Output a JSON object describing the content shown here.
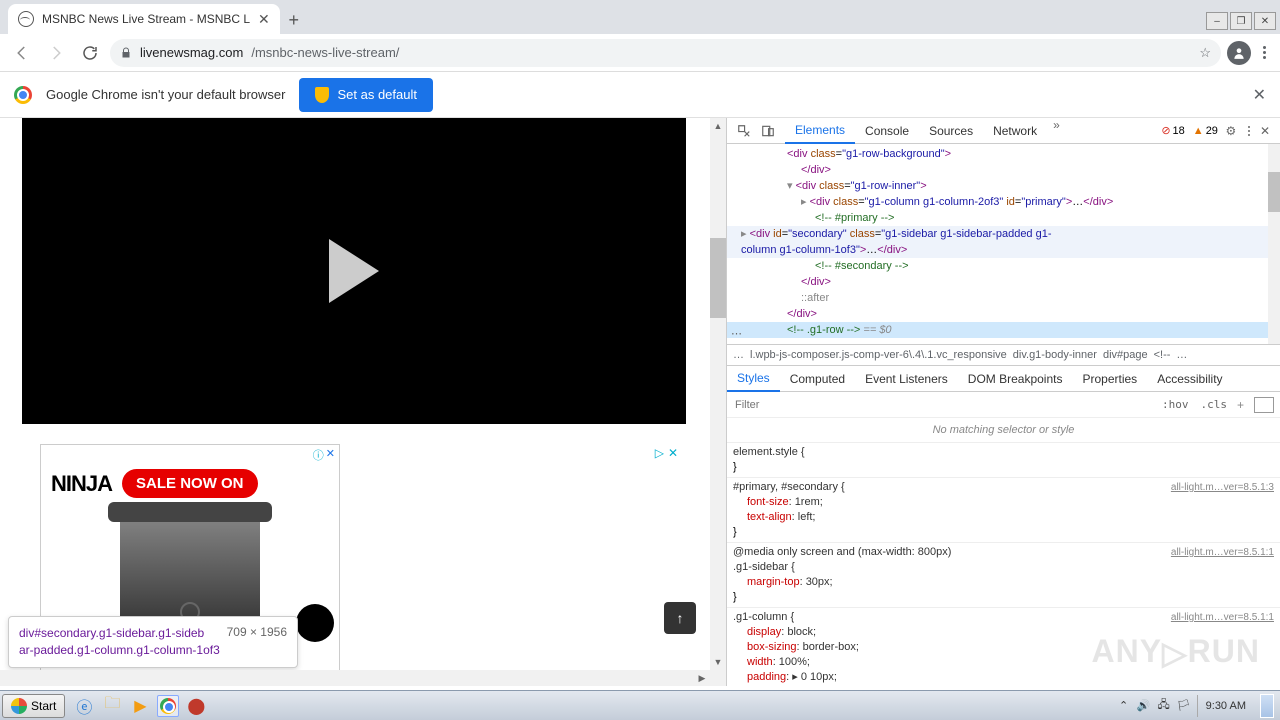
{
  "window": {
    "tab_title": "MSNBC News Live Stream - MSNBC L",
    "minimize": "–",
    "maximize": "❐",
    "close": "✕"
  },
  "url": {
    "host": "livenewsmag.com",
    "path": "/msnbc-news-live-stream/"
  },
  "default_browser": {
    "message": "Google Chrome isn't your default browser",
    "button": "Set as default"
  },
  "ad": {
    "brand": "NINJA",
    "pill": "SALE NOW ON",
    "info_icon": "ⓘ",
    "close_icon": "✕",
    "right_tri": "▷",
    "right_x": "✕"
  },
  "tooltip": {
    "selector": "div#secondary.g1-sidebar.g1-sidebar-padded.g1-column.g1-column-1of3",
    "dims": "709 × 1956"
  },
  "devtools": {
    "tabs": [
      "Elements",
      "Console",
      "Sources",
      "Network"
    ],
    "more": "»",
    "errors": "18",
    "warnings": "29",
    "breadcrumb": [
      "…",
      "l.wpb-js-composer.js-comp-ver-6\\.4\\.1.vc_responsive",
      "div.g1-body-inner",
      "div#page",
      "<!--",
      "…"
    ],
    "styles_tabs": [
      "Styles",
      "Computed",
      "Event Listeners",
      "DOM Breakpoints",
      "Properties",
      "Accessibility"
    ],
    "filter_placeholder": "Filter",
    "hov": ":hov",
    "cls": ".cls",
    "nomatch": "No matching selector or style",
    "dom": {
      "l1": "<div class=\"g1-row-background\">",
      "l2": "</div>",
      "l3": "<div class=\"g1-row-inner\">",
      "l4a": "<div class=\"g1-column g1-column-2of3\" id=\"primary\">",
      "l4b": "…</div>",
      "l5": "<!-- #primary -->",
      "l6a": "<div id=\"secondary\" class=\"g1-sidebar g1-sidebar-padded g1-",
      "l6b": "column g1-column-1of3\">",
      "l6c": "…</div>",
      "l7": "<!-- #secondary -->",
      "l8": "</div>",
      "l9": "::after",
      "l10": "</div>",
      "l11a": "<!-- .g1-row -->",
      "l11b": " == $0"
    },
    "rules": {
      "r0_sel": "element.style {",
      "r0_end": "}",
      "r1_sel": "#primary, #secondary {",
      "r1_p1": "font-size",
      "r1_v1": ": 1rem;",
      "r1_p2": "text-align",
      "r1_v2": ": left;",
      "r1_end": "}",
      "r1_src": "all-light.m…ver=8.5.1:3",
      "r2_media": "@media only screen and (max-width: 800px)",
      "r2_sel": ".g1-sidebar {",
      "r2_p1": "margin-top",
      "r2_v1": ": 30px;",
      "r2_end": "}",
      "r2_src": "all-light.m…ver=8.5.1:1",
      "r3_sel": ".g1-column {",
      "r3_p1": "display",
      "r3_v1": ": block;",
      "r3_p2": "box-sizing",
      "r3_v2": ": border-box;",
      "r3_p3": "width",
      "r3_v3": ": 100%;",
      "r3_p4": "padding",
      "r3_v4": ": ▸ 0 10px;",
      "r3_src": "all-light.m…ver=8.5.1:1"
    }
  },
  "taskbar": {
    "start": "Start",
    "clock": "9:30 AM"
  },
  "watermark": "ANY▷RUN"
}
